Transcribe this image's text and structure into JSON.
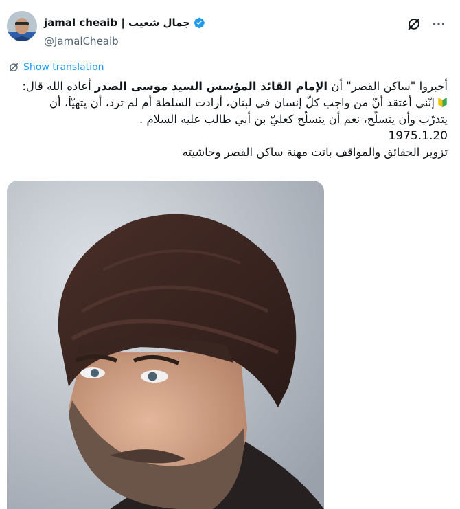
{
  "author": {
    "display_name": "jamal cheaib | جمال شعيب",
    "handle": "@JamalCheaib",
    "verified": true
  },
  "header_icons": [
    "grok-icon",
    "more-icon"
  ],
  "translate_label": "Show translation",
  "tweet": {
    "line1_part1": "أخبروا \"ساكن القصر\" أن ",
    "line1_bold": "الإمام القائد المؤسس السيد موسى الصدر",
    "line1_part2": " أعاده الله قال:",
    "line2": "إنّني أعتقد أنّ من واجب كلّ إنسان في لبنان، أرادت السلطة أم لم ترد، أن يتهيّأ، أن",
    "line3": "يتدرّب وأن يتسلّح، نعم أن يتسلّح كعليّ بن أبي طالب عليه السلام .",
    "line4": "1975.1.20",
    "line5": "تزوير الحقائق والمواقف باتت مهنة ساكن القصر وحاشيته"
  },
  "colors": {
    "accent": "#1d9bf0",
    "secondary_text": "#536471",
    "primary_text": "#0f1419"
  }
}
